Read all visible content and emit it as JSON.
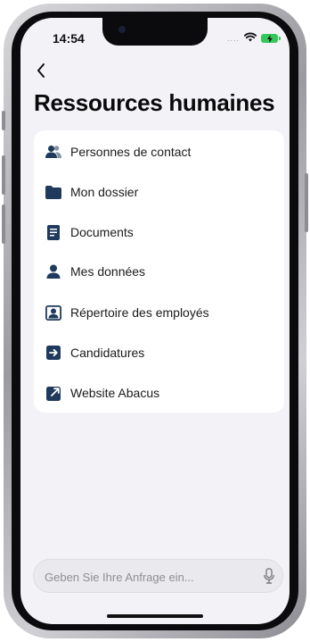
{
  "status_bar": {
    "time": "14:54",
    "signal_dots": "....",
    "icons": [
      "wifi-icon",
      "battery-charging-icon"
    ],
    "battery_color": "#34c759"
  },
  "nav": {
    "back_icon": "chevron-left-icon"
  },
  "page": {
    "title": "Ressources humaines"
  },
  "menu": {
    "icon_color": "#1f3a5c",
    "items": [
      {
        "label": "Personnes de contact",
        "icon": "contacts-icon"
      },
      {
        "label": "Mon dossier",
        "icon": "folder-icon"
      },
      {
        "label": "Documents",
        "icon": "document-icon"
      },
      {
        "label": "Mes données",
        "icon": "person-icon"
      },
      {
        "label": "Répertoire des employés",
        "icon": "employee-directory-icon"
      },
      {
        "label": "Candidatures",
        "icon": "arrow-right-square-icon"
      },
      {
        "label": "Website Abacus",
        "icon": "external-link-icon"
      }
    ]
  },
  "search": {
    "placeholder": "Geben Sie Ihre Anfrage ein...",
    "value": "",
    "mic_icon": "microphone-icon"
  }
}
